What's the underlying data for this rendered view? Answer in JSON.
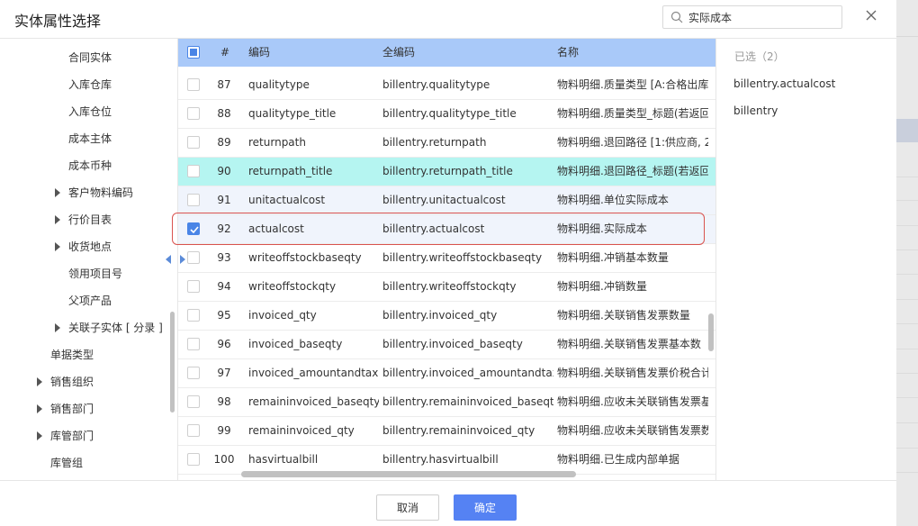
{
  "dialog": {
    "title": "实体属性选择",
    "search": {
      "value": "实际成本",
      "placeholder": ""
    },
    "cancel_label": "取消",
    "ok_label": "确定"
  },
  "tree": {
    "items": [
      {
        "label": "合同实体",
        "expandable": false
      },
      {
        "label": "入库仓库",
        "expandable": false
      },
      {
        "label": "入库仓位",
        "expandable": false
      },
      {
        "label": "成本主体",
        "expandable": false
      },
      {
        "label": "成本币种",
        "expandable": false
      },
      {
        "label": "客户物料编码",
        "expandable": true
      },
      {
        "label": "行价目表",
        "expandable": true
      },
      {
        "label": "收货地点",
        "expandable": true
      },
      {
        "label": "领用项目号",
        "expandable": false
      },
      {
        "label": "父项产品",
        "expandable": false
      },
      {
        "label": "关联子实体 [ 分录 ]",
        "expandable": true
      },
      {
        "label": "单据类型",
        "expandable": false
      },
      {
        "label": "销售组织",
        "expandable": true
      },
      {
        "label": "销售部门",
        "expandable": true
      },
      {
        "label": "库管部门",
        "expandable": true
      },
      {
        "label": "库管组",
        "expandable": false
      }
    ]
  },
  "table": {
    "headers": {
      "num": "#",
      "code": "编码",
      "full": "全编码",
      "name": "名称"
    },
    "rows": [
      {
        "num": "87",
        "code": "qualitytype",
        "full": "billentry.qualitytype",
        "name": "物料明细.质量类型 [A:合格出库,",
        "checked": false
      },
      {
        "num": "88",
        "code": "qualitytype_title",
        "full": "billentry.qualitytype_title",
        "name": "物料明细.质量类型_标题(若返回",
        "checked": false
      },
      {
        "num": "89",
        "code": "returnpath",
        "full": "billentry.returnpath",
        "name": "物料明细.退回路径 [1:供应商, 2:",
        "checked": false
      },
      {
        "num": "90",
        "code": "returnpath_title",
        "full": "billentry.returnpath_title",
        "name": "物料明细.退回路径_标题(若返回",
        "checked": false
      },
      {
        "num": "91",
        "code": "unitactualcost",
        "full": "billentry.unitactualcost",
        "name": "物料明细.单位实际成本",
        "checked": false
      },
      {
        "num": "92",
        "code": "actualcost",
        "full": "billentry.actualcost",
        "name": "物料明细.实际成本",
        "checked": true
      },
      {
        "num": "93",
        "code": "writeoffstockbaseqty",
        "full": "billentry.writeoffstockbaseqty",
        "name": "物料明细.冲销基本数量",
        "checked": false
      },
      {
        "num": "94",
        "code": "writeoffstockqty",
        "full": "billentry.writeoffstockqty",
        "name": "物料明细.冲销数量",
        "checked": false
      },
      {
        "num": "95",
        "code": "invoiced_qty",
        "full": "billentry.invoiced_qty",
        "name": "物料明细.关联销售发票数量",
        "checked": false
      },
      {
        "num": "96",
        "code": "invoiced_baseqty",
        "full": "billentry.invoiced_baseqty",
        "name": "物料明细.关联销售发票基本数",
        "checked": false
      },
      {
        "num": "97",
        "code": "invoiced_amountandtax",
        "full": "billentry.invoiced_amountandtax",
        "name": "物料明细.关联销售发票价税合计",
        "checked": false
      },
      {
        "num": "98",
        "code": "remaininvoiced_baseqty",
        "full": "billentry.remaininvoiced_baseqty",
        "name": "物料明细.应收未关联销售发票基",
        "checked": false
      },
      {
        "num": "99",
        "code": "remaininvoiced_qty",
        "full": "billentry.remaininvoiced_qty",
        "name": "物料明细.应收未关联销售发票数",
        "checked": false
      },
      {
        "num": "100",
        "code": "hasvirtualbill",
        "full": "billentry.hasvirtualbill",
        "name": "物料明细.已生成内部单据",
        "checked": false
      }
    ]
  },
  "selected": {
    "title": "已选（2）",
    "items": [
      "billentry.actualcost",
      "billentry"
    ]
  }
}
